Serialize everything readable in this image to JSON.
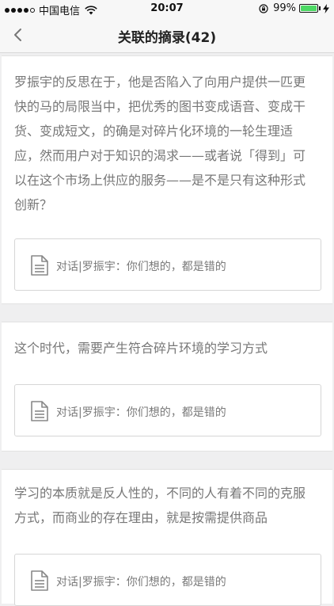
{
  "status_bar": {
    "carrier": "中国电信",
    "time": "20:07",
    "battery_percent_text": "99%",
    "battery_level": 0.99,
    "accent_color": "#4cd964"
  },
  "nav": {
    "title": "关联的摘录(42)",
    "back_icon": "chevron-left-icon"
  },
  "excerpts": [
    {
      "lines": [
        "罗振宇的反思在于，他是否陷入了向用户提供一匹更",
        "快的马的局限当中，把优秀的图书变成语音、变成干",
        "货、变成短文，的确是对碎片化环境的一轮生理适",
        "应，然而用户对于知识的渴求——或者说「得到」可",
        "以在这个市场上供应的服务——是不是只有这种形式",
        "创新？"
      ],
      "source": "对话|罗振宇：你们想的，都是错的",
      "source_icon": "document-icon"
    },
    {
      "lines": [
        "这个时代，需要产生符合碎片环境的学习方式"
      ],
      "source": "对话|罗振宇：你们想的，都是错的",
      "source_icon": "document-icon"
    },
    {
      "lines": [
        "学习的本质就是反人性的，不同的人有着不同的克服",
        "方式，而商业的存在理由，就是按需提供商品"
      ],
      "source": "对话|罗振宇：你们想的，都是错的",
      "source_icon": "document-icon"
    }
  ]
}
